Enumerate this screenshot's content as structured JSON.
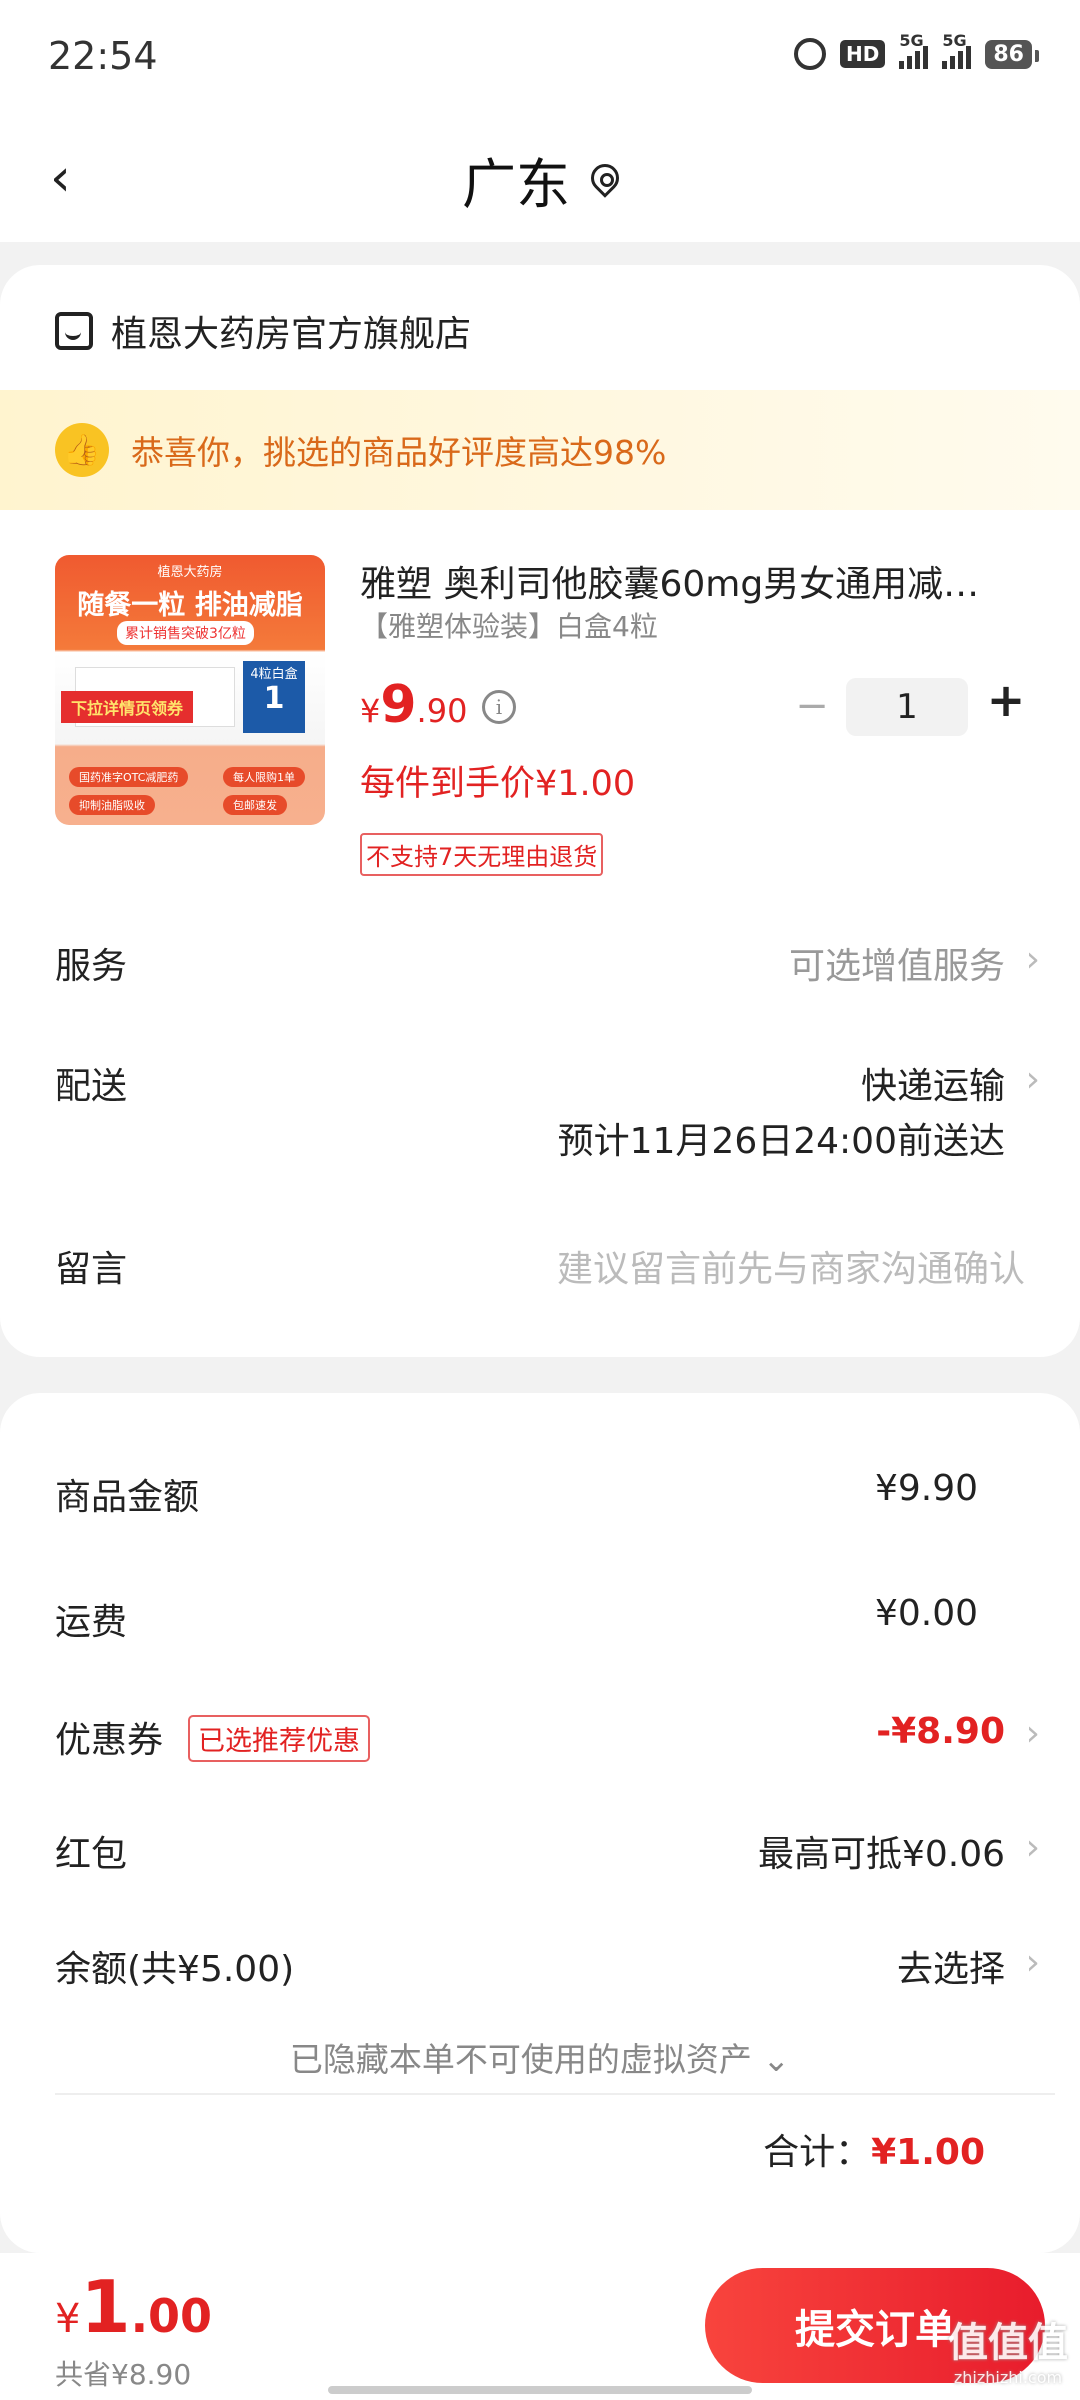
{
  "status_bar": {
    "time": "22:54",
    "hd": "HD",
    "net1": "5G",
    "net2": "5G",
    "battery": "86"
  },
  "nav": {
    "title": "广东"
  },
  "shop": {
    "name": "植恩大药房官方旗舰店"
  },
  "banner": {
    "text": "恭喜你，挑选的商品好评度高达98%"
  },
  "product": {
    "title": "雅塑 奥利司他胶囊60mg男女通用减…",
    "spec": "【雅塑体验装】白盒4粒",
    "price_currency": "¥",
    "price_int": "9",
    "price_dec": ".90",
    "quantity": "1",
    "deal_price": "每件到手价¥1.00",
    "return_policy": "不支持7天无理由退货",
    "image": {
      "top": "植恩大药房",
      "headline": "随餐一粒 排油减脂",
      "sub": "累计销售突破3亿粒",
      "coupon": "下拉详情页领券",
      "count_label": "4粒白盒",
      "count": "1",
      "tags": [
        "国药准字OTC减肥药",
        "每人限购1单",
        "抑制油脂吸收",
        "包邮速发"
      ]
    }
  },
  "rows": {
    "service_label": "服务",
    "service_value": "可选增值服务",
    "delivery_label": "配送",
    "delivery_value": "快递运输",
    "delivery_eta": "预计11月26日24:00前送达",
    "message_label": "留言",
    "message_placeholder": "建议留言前先与商家沟通确认"
  },
  "summary": {
    "goods_label": "商品金额",
    "goods_value": "¥9.90",
    "shipping_label": "运费",
    "shipping_value": "¥0.00",
    "coupon_label": "优惠券",
    "coupon_badge": "已选推荐优惠",
    "coupon_value": "-¥8.90",
    "redpacket_label": "红包",
    "redpacket_value": "最高可抵¥0.06",
    "balance_label": "余额(共¥5.00)",
    "balance_value": "去选择",
    "hidden_assets": "已隐藏本单不可使用的虚拟资产",
    "total_label": "合计：",
    "total_value": "¥1.00"
  },
  "bottom": {
    "price_currency": "¥",
    "price_int": "1",
    "price_dec": ".00",
    "saved": "共省¥8.90",
    "submit": "提交订单"
  },
  "watermark": {
    "main": "值值值",
    "sub": "zhizhizhi.com"
  },
  "colors": {
    "accent_red": "#e22222",
    "banner_text": "#d9691a",
    "banner_bg": "#fff4cf"
  }
}
